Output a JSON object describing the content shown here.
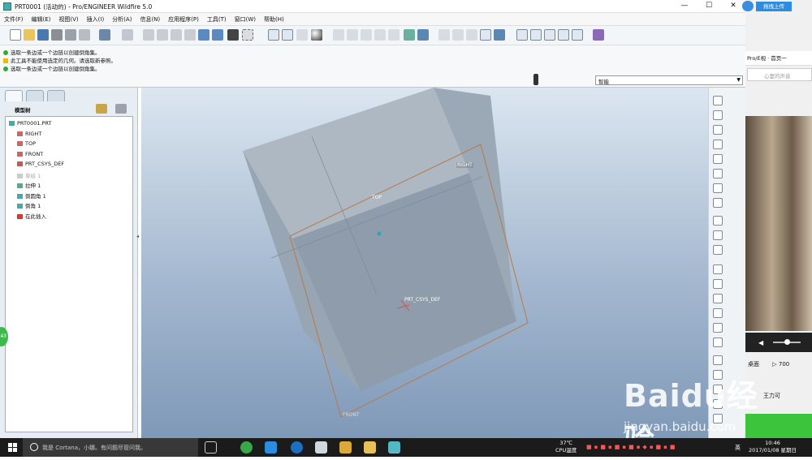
{
  "window": {
    "title": "PRT0001 (活动的) - Pro/ENGINEER Wildfire 5.0",
    "controls": {
      "minimize": "—",
      "maximize": "☐",
      "close": "✕"
    }
  },
  "menu": [
    "文件(F)",
    "编辑(E)",
    "视图(V)",
    "插入(I)",
    "分析(A)",
    "信息(N)",
    "应用程序(P)",
    "工具(T)",
    "窗口(W)",
    "帮助(H)"
  ],
  "messages": [
    {
      "icon": "green-arrow",
      "text": "选取一条边或一个边链以创建倒角集。"
    },
    {
      "icon": "warning",
      "text": "此工具不能使用选定的几何。请选取新参照。"
    },
    {
      "icon": "green-arrow",
      "text": "选取一条边或一个边链以创建倒角集。"
    }
  ],
  "filter": {
    "value": "智能"
  },
  "model_tree": {
    "title": "模型树",
    "items": [
      {
        "label": "PRT0001.PRT",
        "icon": "part-icon",
        "indent": 0,
        "dim": false
      },
      {
        "label": "RIGHT",
        "icon": "datum-plane-icon",
        "indent": 1,
        "dim": false
      },
      {
        "label": "TOP",
        "icon": "datum-plane-icon",
        "indent": 1,
        "dim": false
      },
      {
        "label": "FRONT",
        "icon": "datum-plane-icon",
        "indent": 1,
        "dim": false
      },
      {
        "label": "PRT_CSYS_DEF",
        "icon": "csys-icon",
        "indent": 1,
        "dim": false
      },
      {
        "label": "草绘 1",
        "icon": "sketch-icon",
        "indent": 1,
        "dim": true
      },
      {
        "label": "拉伸 1",
        "icon": "extrude-icon",
        "indent": 1,
        "dim": false
      },
      {
        "label": "倒圆角 1",
        "icon": "round-icon",
        "indent": 1,
        "dim": false
      },
      {
        "label": "倒角 1",
        "icon": "chamfer-icon",
        "indent": 1,
        "dim": false
      },
      {
        "label": "在此插入",
        "icon": "insert-here-arrow",
        "indent": 1,
        "dim": false
      }
    ]
  },
  "viewport": {
    "labels": {
      "right": "RIGHT",
      "top": "TOP",
      "csys": "PRT_CSYS_DEF",
      "front": "FRONT"
    },
    "colors": {
      "model": "#a9b3bd",
      "datum": "#b87a4a"
    }
  },
  "sidebar": {
    "upload": "拖拽上传",
    "tabs": "Pro/E视 · 首页一",
    "search_placeholder": "心里的声音",
    "desk": "桌面",
    "count": "700",
    "caption": "王力可"
  },
  "side_fab": "43",
  "watermark": {
    "logo": "Baidu经验",
    "url": "jingyan.baidu.com"
  },
  "taskbar": {
    "cortana": "我是 Cortana，小娜。有问题尽管问我。",
    "temp": "37℃",
    "temp_label": "CPU温度",
    "lang": "英",
    "time": "10:46",
    "date": "2017/01/08 星期日"
  }
}
